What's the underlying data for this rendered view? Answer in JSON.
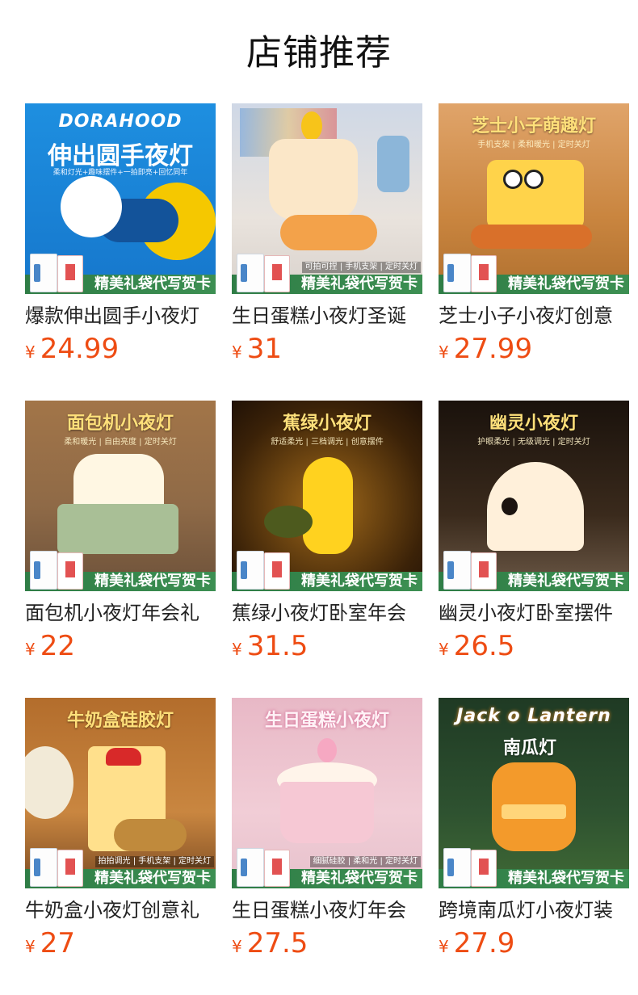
{
  "header": {
    "title": "店铺推荐"
  },
  "colors": {
    "price": "#ee4c13",
    "banner_green": "#2f7d46"
  },
  "products": [
    {
      "name": "爆款伸出圆手小夜灯",
      "price": "24.99",
      "thumb": {
        "brand": "DORAHOOD",
        "title": "伸出圆手夜灯",
        "subtitle": "柔和灯光+趣味摆件+一拍即亮+回忆同年",
        "side": "",
        "banner": "精美礼袋代写贺卡"
      }
    },
    {
      "name": "生日蛋糕小夜灯圣诞",
      "price": "31",
      "thumb": {
        "brand": "",
        "title": "",
        "subtitle": "",
        "side": "可拍可捏 | 手机支架 | 定时关灯",
        "banner": "精美礼袋代写贺卡"
      }
    },
    {
      "name": "芝士小子小夜灯创意",
      "price": "27.99",
      "thumb": {
        "brand": "",
        "title": "芝士小子萌趣灯",
        "subtitle": "手机支架 | 柔和暖光 | 定时关灯",
        "side": "",
        "banner": "精美礼袋代写贺卡"
      }
    },
    {
      "name": "面包机小夜灯年会礼",
      "price": "22",
      "thumb": {
        "brand": "",
        "title": "面包机小夜灯",
        "subtitle": "柔和暖光 | 自由亮度 | 定时关灯",
        "side": "",
        "banner": "精美礼袋代写贺卡"
      }
    },
    {
      "name": "蕉绿小夜灯卧室年会",
      "price": "31.5",
      "thumb": {
        "brand": "",
        "title": "蕉绿小夜灯",
        "subtitle": "舒适柔光 | 三档调光 | 创意摆件",
        "side": "",
        "banner": "精美礼袋代写贺卡"
      }
    },
    {
      "name": "幽灵小夜灯卧室摆件",
      "price": "26.5",
      "thumb": {
        "brand": "",
        "title": "幽灵小夜灯",
        "subtitle": "护眼柔光 | 无级调光 | 定时关灯",
        "side": "",
        "banner": "精美礼袋代写贺卡"
      }
    },
    {
      "name": "牛奶盒小夜灯创意礼",
      "price": "27",
      "thumb": {
        "brand": "",
        "title": "牛奶盒硅胶灯",
        "subtitle": "",
        "side": "拍拍调光 | 手机支架 | 定时关灯",
        "banner": "精美礼袋代写贺卡"
      }
    },
    {
      "name": "生日蛋糕小夜灯年会",
      "price": "27.5",
      "thumb": {
        "brand": "",
        "title": "生日蛋糕小夜灯",
        "subtitle": "",
        "side": "细腻硅胶 | 柔和光 | 定时关灯",
        "banner": "精美礼袋代写贺卡"
      }
    },
    {
      "name": "跨境南瓜灯小夜灯装",
      "price": "27.9",
      "thumb": {
        "brand": "Jack o Lantern",
        "title": "南瓜灯",
        "subtitle": "",
        "side": "",
        "banner": "精美礼袋代写贺卡"
      }
    }
  ],
  "currency": "¥"
}
